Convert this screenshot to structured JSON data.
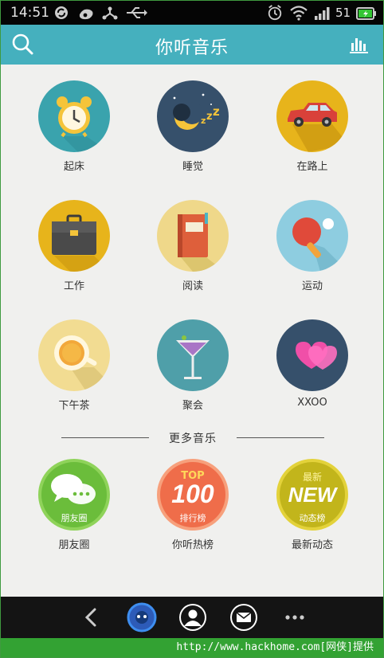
{
  "status_bar": {
    "time": "14:51",
    "battery": "51",
    "icons": [
      "sync-icon",
      "weibo-icon",
      "share-icon",
      "usb-icon",
      "alarm-icon",
      "wifi-icon",
      "signal-icon",
      "battery-icon"
    ]
  },
  "header": {
    "title": "你听音乐",
    "search_icon": "search-icon",
    "charts_icon": "equalizer-icon",
    "color": "#45b0be"
  },
  "scenes": [
    {
      "label": "起床",
      "icon": "alarm-clock-icon",
      "bg": "#3aa3ad"
    },
    {
      "label": "睡觉",
      "icon": "moon-sleep-icon",
      "bg": "#36506b"
    },
    {
      "label": "在路上",
      "icon": "car-icon",
      "bg": "#e7b41b"
    },
    {
      "label": "工作",
      "icon": "briefcase-icon",
      "bg": "#e7b41b"
    },
    {
      "label": "阅读",
      "icon": "book-icon",
      "bg": "#efd88a"
    },
    {
      "label": "运动",
      "icon": "ping-pong-icon",
      "bg": "#8ecde0"
    },
    {
      "label": "下午茶",
      "icon": "teacup-icon",
      "bg": "#f2dc92"
    },
    {
      "label": "聚会",
      "icon": "cocktail-icon",
      "bg": "#4f9fa9"
    },
    {
      "label": "XXOO",
      "icon": "hearts-icon",
      "bg": "#36506b"
    }
  ],
  "more": {
    "label": "更多音乐",
    "items": [
      {
        "label": "朋友圈",
        "badge": "朋友圈",
        "icon": "chat-bubbles-icon",
        "bg": "#6bbd3b"
      },
      {
        "label": "你听热榜",
        "badge_top": "TOP",
        "badge_big": "100",
        "badge": "排行榜",
        "icon": "top100-icon",
        "bg": "#ef6d4a"
      },
      {
        "label": "最新动态",
        "badge_top": "最新",
        "badge_big": "NEW",
        "badge": "动态榜",
        "icon": "new-icon",
        "bg": "#c2b51b"
      }
    ]
  },
  "nav": {
    "icons": [
      "back-icon",
      "music-disc-icon",
      "profile-icon",
      "mail-icon",
      "more-icon"
    ]
  },
  "watermark": "http://www.hackhome.com[网侠]提供"
}
